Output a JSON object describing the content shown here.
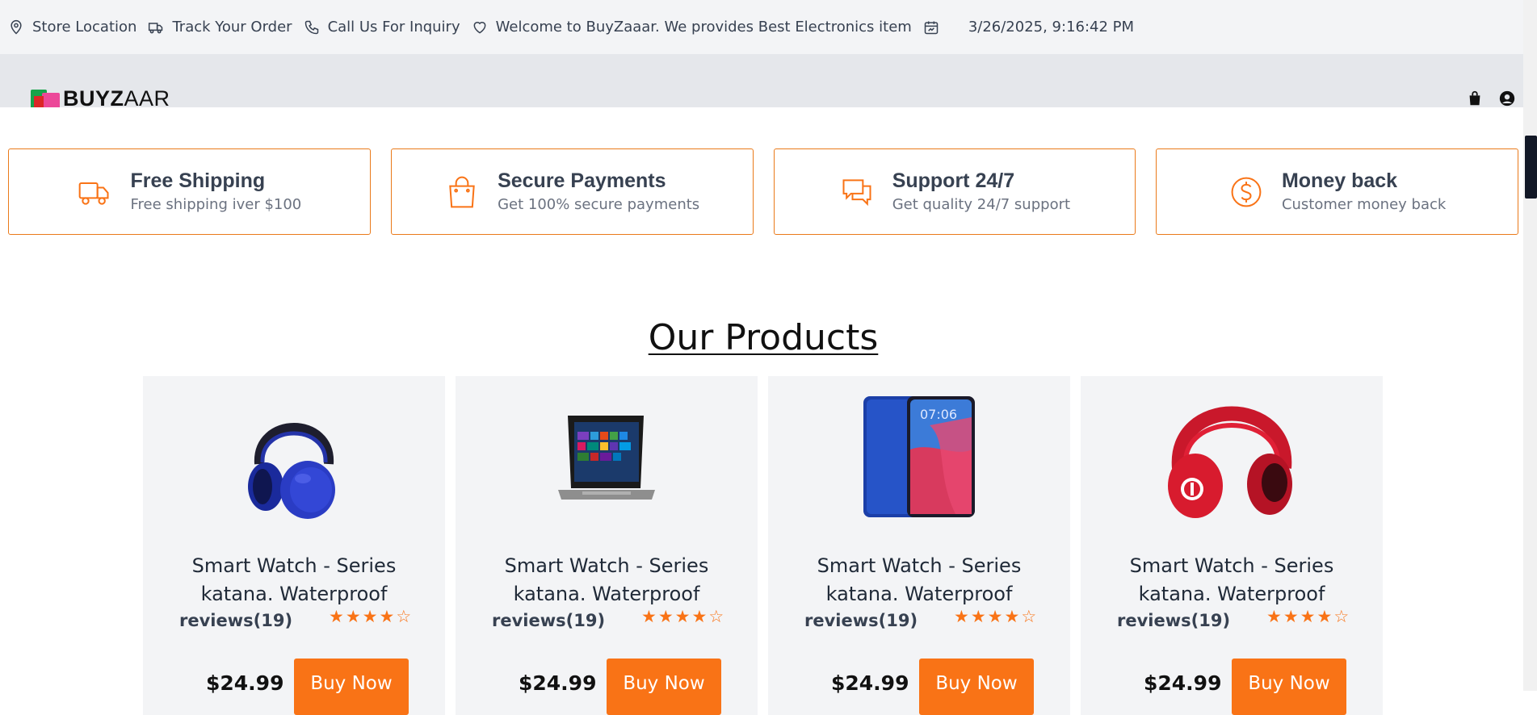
{
  "topbar": {
    "store_location": "Store Location",
    "track_order": "Track Your Order",
    "call_us": "Call Us For Inquiry",
    "welcome": "Welcome to BuyZaaar. We provides Best Electronics item",
    "datetime": "3/26/2025, 9:16:42 PM"
  },
  "navbar": {
    "logo_bold": "BUYZ",
    "logo_light": "AAR"
  },
  "features": [
    {
      "title": "Free Shipping",
      "subtitle": "Free shipping iver $100",
      "icon": "truck-icon"
    },
    {
      "title": "Secure Payments",
      "subtitle": "Get 100% secure payments",
      "icon": "shopping-bag-icon"
    },
    {
      "title": "Support 24/7",
      "subtitle": "Get quality 24/7 support",
      "icon": "chat-icon"
    },
    {
      "title": "Money back",
      "subtitle": "Customer money back",
      "icon": "dollar-coin-icon"
    }
  ],
  "section_title": "Our Products",
  "products": [
    {
      "name": "Smart Watch - Series katana. Waterproof",
      "reviews": "reviews(19)",
      "rating": 4,
      "max_rating": 5,
      "price": "$24.99",
      "button": "Buy Now",
      "image": "blue-headphones"
    },
    {
      "name": "Smart Watch - Series katana. Waterproof",
      "reviews": "reviews(19)",
      "rating": 4,
      "max_rating": 5,
      "price": "$24.99",
      "button": "Buy Now",
      "image": "laptop"
    },
    {
      "name": "Smart Watch - Series katana. Waterproof",
      "reviews": "reviews(19)",
      "rating": 4,
      "max_rating": 5,
      "price": "$24.99",
      "button": "Buy Now",
      "image": "smartphone",
      "phone_clock": "07:06"
    },
    {
      "name": "Smart Watch - Series katana. Waterproof",
      "reviews": "reviews(19)",
      "rating": 4,
      "max_rating": 5,
      "price": "$24.99",
      "button": "Buy Now",
      "image": "red-headphones"
    }
  ],
  "colors": {
    "accent": "#f97316",
    "topbar_bg": "#f3f4f6",
    "navbar_bg": "#e5e7eb",
    "card_bg": "#f3f4f6"
  }
}
